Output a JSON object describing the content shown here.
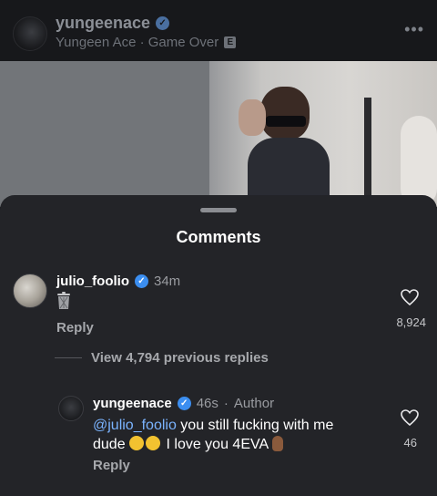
{
  "post": {
    "username": "yungeenace",
    "subtitle": "Yungeen Ace · Game Over",
    "explicit_badge": "E",
    "more_icon": "more-horizontal-icon"
  },
  "sheet": {
    "title": "Comments"
  },
  "comment": {
    "username": "julio_foolio",
    "time": "34m",
    "body_icon": "wastebasket-emoji",
    "likes": "8,924",
    "reply_label": "Reply"
  },
  "view_replies": "View 4,794 previous replies",
  "reply": {
    "username": "yungeenace",
    "time": "46s",
    "author_label": "Author",
    "mention": "@julio_foolio",
    "text_part1": " you still fucking with me dude ",
    "text_part2": " I love you 4EVA",
    "likes": "46",
    "reply_label": "Reply"
  },
  "colors": {
    "background": "#101114",
    "sheet": "#232428",
    "verified": "#3b8ef0",
    "mention": "#7bb4ff"
  }
}
